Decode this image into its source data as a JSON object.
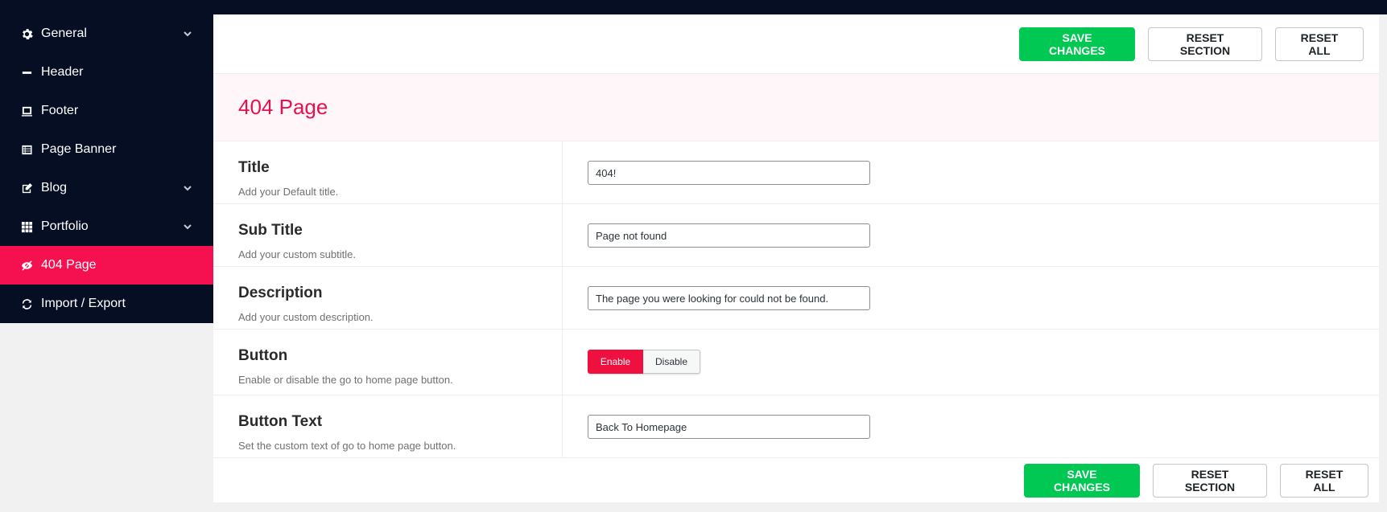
{
  "sidebar": {
    "items": [
      {
        "label": "General",
        "icon": "gear-icon",
        "has_submenu": true
      },
      {
        "label": "Header",
        "icon": "minus-icon",
        "has_submenu": false
      },
      {
        "label": "Footer",
        "icon": "laptop-icon",
        "has_submenu": false
      },
      {
        "label": "Page Banner",
        "icon": "list-alt-icon",
        "has_submenu": false
      },
      {
        "label": "Blog",
        "icon": "edit-icon",
        "has_submenu": true
      },
      {
        "label": "Portfolio",
        "icon": "grid-icon",
        "has_submenu": true
      },
      {
        "label": "404 Page",
        "icon": "eye-slash-icon",
        "has_submenu": false,
        "active": true
      },
      {
        "label": "Import / Export",
        "icon": "refresh-icon",
        "has_submenu": false
      }
    ]
  },
  "toolbar": {
    "save_label": "SAVE CHANGES",
    "reset_section_label": "RESET SECTION",
    "reset_all_label": "RESET ALL"
  },
  "section": {
    "title": "404 Page"
  },
  "fields": {
    "title": {
      "label": "Title",
      "desc": "Add your Default title.",
      "value": "404!"
    },
    "subtitle": {
      "label": "Sub Title",
      "desc": "Add your custom subtitle.",
      "value": "Page not found"
    },
    "description": {
      "label": "Description",
      "desc": "Add your custom description.",
      "value": "The page you were looking for could not be found."
    },
    "button": {
      "label": "Button",
      "desc": "Enable or disable the go to home page button.",
      "enable_label": "Enable",
      "disable_label": "Disable",
      "selected": "Enable"
    },
    "button_text": {
      "label": "Button Text",
      "desc": "Set the custom text of go to home page button.",
      "value": "Back To Homepage"
    }
  },
  "colors": {
    "sidebar_bg": "#060e24",
    "active": "#f5104f",
    "save": "#00c853",
    "accent_title": "#e5114f"
  }
}
